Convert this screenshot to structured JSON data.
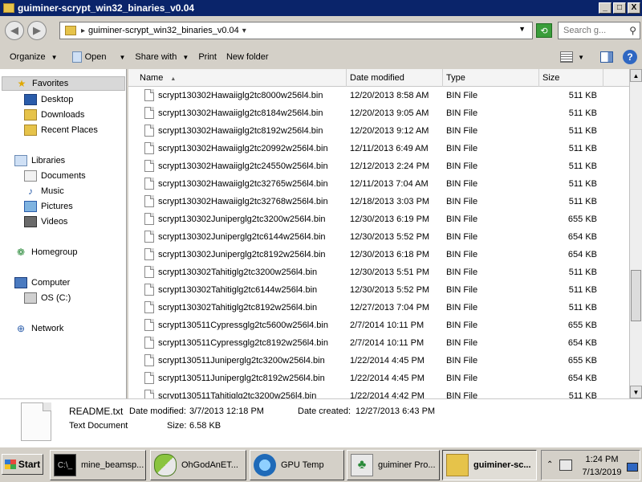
{
  "window": {
    "title": "guiminer-scrypt_win32_binaries_v0.04",
    "btn_min": "_",
    "btn_max": "□",
    "btn_close": "X"
  },
  "address": {
    "path": "guiminer-scrypt_win32_binaries_v0.04",
    "search_placeholder": "Search g..."
  },
  "toolbar": {
    "organize": "Organize",
    "open": "Open",
    "share_with": "Share with",
    "print": "Print",
    "new_folder": "New folder"
  },
  "nav": {
    "favorites": "Favorites",
    "desktop": "Desktop",
    "downloads": "Downloads",
    "recent_places": "Recent Places",
    "libraries": "Libraries",
    "documents": "Documents",
    "music": "Music",
    "pictures": "Pictures",
    "videos": "Videos",
    "homegroup": "Homegroup",
    "computer": "Computer",
    "os_c": "OS (C:)",
    "network": "Network"
  },
  "columns": {
    "name": "Name",
    "date_modified": "Date modified",
    "type": "Type",
    "size": "Size"
  },
  "files": [
    {
      "name": "scrypt130302Hawaiiglg2tc8000w256l4.bin",
      "date": "12/20/2013 8:58 AM",
      "type": "BIN File",
      "size": "511 KB"
    },
    {
      "name": "scrypt130302Hawaiiglg2tc8184w256l4.bin",
      "date": "12/20/2013 9:05 AM",
      "type": "BIN File",
      "size": "511 KB"
    },
    {
      "name": "scrypt130302Hawaiiglg2tc8192w256l4.bin",
      "date": "12/20/2013 9:12 AM",
      "type": "BIN File",
      "size": "511 KB"
    },
    {
      "name": "scrypt130302Hawaiiglg2tc20992w256l4.bin",
      "date": "12/11/2013 6:49 AM",
      "type": "BIN File",
      "size": "511 KB"
    },
    {
      "name": "scrypt130302Hawaiiglg2tc24550w256l4.bin",
      "date": "12/12/2013 2:24 PM",
      "type": "BIN File",
      "size": "511 KB"
    },
    {
      "name": "scrypt130302Hawaiiglg2tc32765w256l4.bin",
      "date": "12/11/2013 7:04 AM",
      "type": "BIN File",
      "size": "511 KB"
    },
    {
      "name": "scrypt130302Hawaiiglg2tc32768w256l4.bin",
      "date": "12/18/2013 3:03 PM",
      "type": "BIN File",
      "size": "511 KB"
    },
    {
      "name": "scrypt130302Juniperglg2tc3200w256l4.bin",
      "date": "12/30/2013 6:19 PM",
      "type": "BIN File",
      "size": "655 KB"
    },
    {
      "name": "scrypt130302Juniperglg2tc6144w256l4.bin",
      "date": "12/30/2013 5:52 PM",
      "type": "BIN File",
      "size": "654 KB"
    },
    {
      "name": "scrypt130302Juniperglg2tc8192w256l4.bin",
      "date": "12/30/2013 6:18 PM",
      "type": "BIN File",
      "size": "654 KB"
    },
    {
      "name": "scrypt130302Tahitiglg2tc3200w256l4.bin",
      "date": "12/30/2013 5:51 PM",
      "type": "BIN File",
      "size": "511 KB"
    },
    {
      "name": "scrypt130302Tahitiglg2tc6144w256l4.bin",
      "date": "12/30/2013 5:52 PM",
      "type": "BIN File",
      "size": "511 KB"
    },
    {
      "name": "scrypt130302Tahitiglg2tc8192w256l4.bin",
      "date": "12/27/2013 7:04 PM",
      "type": "BIN File",
      "size": "511 KB"
    },
    {
      "name": "scrypt130511Cypressglg2tc5600w256l4.bin",
      "date": "2/7/2014 10:11 PM",
      "type": "BIN File",
      "size": "655 KB"
    },
    {
      "name": "scrypt130511Cypressglg2tc8192w256l4.bin",
      "date": "2/7/2014 10:11 PM",
      "type": "BIN File",
      "size": "654 KB"
    },
    {
      "name": "scrypt130511Juniperglg2tc3200w256l4.bin",
      "date": "1/22/2014 4:45 PM",
      "type": "BIN File",
      "size": "655 KB"
    },
    {
      "name": "scrypt130511Juniperglg2tc8192w256l4.bin",
      "date": "1/22/2014 4:45 PM",
      "type": "BIN File",
      "size": "654 KB"
    },
    {
      "name": "scrypt130511Tahitiglg2tc3200w256l4.bin",
      "date": "1/22/2014 4:42 PM",
      "type": "BIN File",
      "size": "511 KB"
    }
  ],
  "details": {
    "filename": "README.txt",
    "filetype": "Text Document",
    "modified_label": "Date modified:",
    "modified_value": "3/7/2013 12:18 PM",
    "size_label": "Size:",
    "size_value": "6.58 KB",
    "created_label": "Date created:",
    "created_value": "12/27/2013 6:43 PM"
  },
  "taskbar": {
    "start": "Start",
    "items": [
      "mine_beamsp...",
      "OhGodAnET...",
      "GPU Temp",
      "guiminer Pro...",
      "guiminer-sc..."
    ],
    "time": "1:24 PM",
    "date": "7/13/2019"
  }
}
